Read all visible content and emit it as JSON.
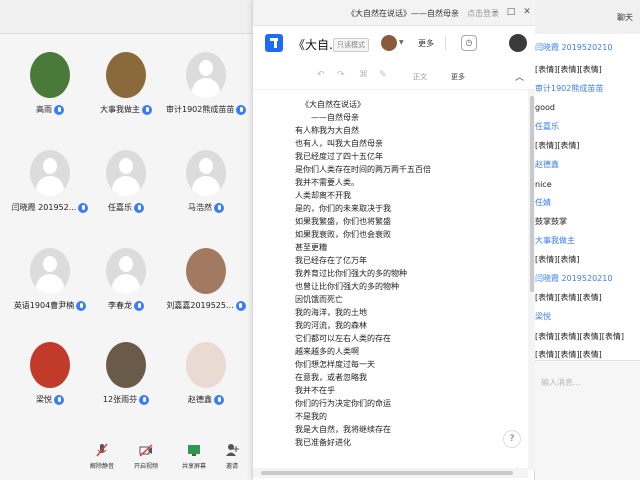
{
  "meeting": {
    "topbar_right": "聊天",
    "participants": [
      {
        "name": "高雨",
        "photo": true,
        "color": "#4a7a3a"
      },
      {
        "name": "大事我做主",
        "photo": true,
        "color": "#8a6a3a"
      },
      {
        "name": "审计1902熊成苗苗",
        "photo": false
      },
      {
        "name": "闫晓霞 201952...",
        "photo": false
      },
      {
        "name": "任嘉乐",
        "photo": false
      },
      {
        "name": "马浩然",
        "photo": false
      },
      {
        "name": "英语1904曹尹楠",
        "photo": false
      },
      {
        "name": "李春龙",
        "photo": false
      },
      {
        "name": "刘嘉嘉2019525...",
        "photo": true,
        "color": "#a27a62"
      },
      {
        "name": "梁悦",
        "photo": true,
        "color": "#c23a2a"
      },
      {
        "name": "12张雨芬",
        "photo": true,
        "color": "#6a5a4a"
      },
      {
        "name": "赵德鑫",
        "photo": true,
        "color": "#e9dad2"
      }
    ],
    "bottom_buttons": [
      {
        "label": "解除静音",
        "icon": "mic-off-icon"
      },
      {
        "label": "开启视频",
        "icon": "video-off-icon"
      },
      {
        "label": "共享屏幕",
        "icon": "share-screen-icon"
      },
      {
        "label": "邀请",
        "icon": "invite-icon"
      }
    ]
  },
  "doc_window": {
    "title": "《大自然在说话》——自然母亲",
    "title_suffix": "点击登录",
    "doc_title": "《大自...",
    "saved_tag": "只读模式",
    "more": "更多",
    "toolbar": {
      "undo": "↶",
      "redo": "↷",
      "format_painter": "⌘",
      "clear": "✎",
      "body_text": "正文",
      "more": "更多",
      "collapse": "︿"
    },
    "lines": [
      "《大自然在说话》",
      "——自然母亲",
      "有人称我为大自然",
      "也有人，叫我大自然母亲",
      "我已经度过了四十五亿年",
      "是你们人类存在时间的两万两千五百倍",
      "我并不需要人类。",
      "人类却离不开我",
      "是的，你们的未来取决于我",
      "如果我繁盛，你们也将繁盛",
      "如果我衰败，你们也会衰败",
      "甚至更糟",
      "我已经存在了亿万年",
      "我养育过比你们强大的多的物种",
      "也曾让比你们强大的多的物种",
      "因饥饿而死亡",
      "我的海洋，我的土地",
      "我的河流，我的森林",
      "它们都可以左右人类的存在",
      "越来越多的人类啊",
      "你们想怎样度过每一天",
      "在意我，或者忽略我",
      "我并不在乎",
      "你们的行为决定你们的命运",
      "不是我的",
      "我是大自然，我将继续存在",
      "我已准备好进化"
    ],
    "help": "?"
  },
  "chat": {
    "header": "聊天",
    "messages": [
      {
        "text": "闫晓霞 2019520210",
        "is_name": true
      },
      {
        "text": "[表情][表情][表情]",
        "is_name": false
      },
      {
        "text": "审计1902熊成苗苗",
        "is_name": true
      },
      {
        "text": "good",
        "is_name": false
      },
      {
        "text": "任嘉乐",
        "is_name": true
      },
      {
        "text": "[表情][表情]",
        "is_name": false
      },
      {
        "text": "赵德鑫",
        "is_name": true
      },
      {
        "text": "nice",
        "is_name": false
      },
      {
        "text": "任婧",
        "is_name": true
      },
      {
        "text": "鼓掌鼓掌",
        "is_name": false
      },
      {
        "text": "大事我做主",
        "is_name": true
      },
      {
        "text": "[表情][表情]",
        "is_name": false
      },
      {
        "text": "闫晓霞 2019520210",
        "is_name": true
      },
      {
        "text": "[表情][表情][表情]",
        "is_name": false
      },
      {
        "text": "梁悦",
        "is_name": true
      },
      {
        "text": "[表情][表情][表情][表情]",
        "is_name": false
      },
      {
        "text": "[表情][表情][表情]",
        "is_name": false
      }
    ],
    "input_placeholder": "输入消息..."
  },
  "colors": {
    "accent": "#3a7df5",
    "doc_brand": "#1e6cf5"
  }
}
